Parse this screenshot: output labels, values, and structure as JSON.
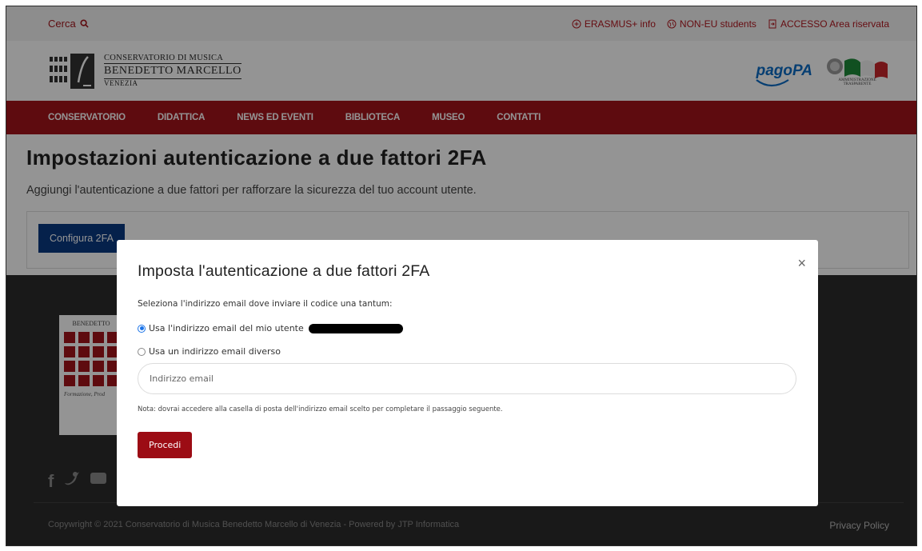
{
  "topbar": {
    "search_label": "Cerca",
    "links": [
      {
        "label": "ERASMUS+ info"
      },
      {
        "label": "NON-EU students"
      },
      {
        "label": "ACCESSO Area riservata"
      }
    ]
  },
  "header": {
    "logo_line1": "CONSERVATORIO DI MUSICA",
    "logo_line2": "BENEDETTO MARCELLO",
    "logo_line3": "VENEZIA",
    "pagopa": "pagoPA",
    "amm_trasparente": "AMMINISTRAZIONE TRASPARENTE"
  },
  "nav": {
    "items": [
      "CONSERVATORIO",
      "DIDATTICA",
      "NEWS ED EVENTI",
      "BIBLIOTECA",
      "MUSEO",
      "CONTATTI"
    ]
  },
  "page": {
    "title": "Impostazioni autenticazione a due fattori 2FA",
    "subtitle": "Aggiungi l'autenticazione a due fattori per rafforzare la sicurezza del tuo account utente.",
    "configure_button": "Configura 2FA"
  },
  "footer": {
    "logo_text": "BENEDETTO",
    "tagline": "Formazione, Prod",
    "copyright": "Copywright © 2021 Conservatorio di Musica Benedetto Marcello di Venezia - Powered by JTP Informatica",
    "privacy": "Privacy Policy"
  },
  "modal": {
    "title": "Imposta l'autenticazione a due fattori 2FA",
    "prompt": "Seleziona l'indirizzo email dove inviare il codice una tantum:",
    "option_user": "Usa l'indirizzo email del mio utente",
    "option_other": "Usa un indirizzo email diverso",
    "email_placeholder": "Indirizzo email",
    "note": "Nota: dovrai accedere alla casella di posta dell'indirizzo email scelto per completare il passaggio seguente.",
    "submit": "Procedi",
    "close": "×"
  },
  "colors": {
    "brand_red": "#a3141b",
    "button_blue": "#0a3a82",
    "submit_red": "#9c0c14"
  }
}
